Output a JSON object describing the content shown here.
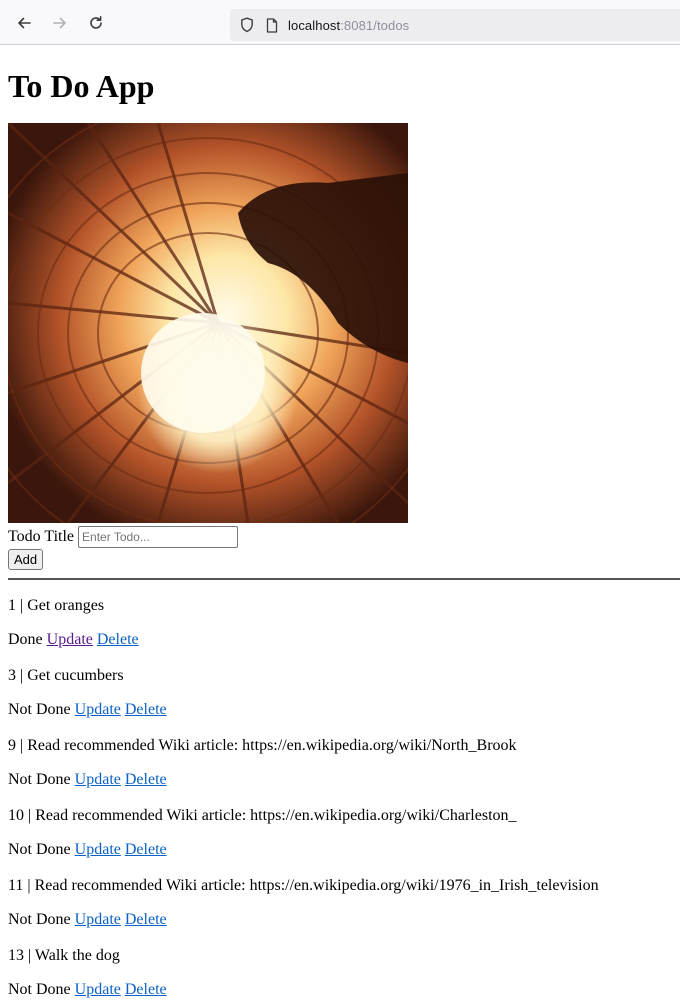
{
  "browser": {
    "url_host": "localhost",
    "url_rest": ":8081/todos"
  },
  "page": {
    "title": "To Do App",
    "form": {
      "label": "Todo Title",
      "placeholder": "Enter Todo...",
      "value": "",
      "add_label": "Add"
    },
    "todos": [
      {
        "title": "1 | Get oranges",
        "status": "Done",
        "update": "Update",
        "delete": "Delete"
      },
      {
        "title": "3 | Get cucumbers",
        "status": "Not Done",
        "update": "Update",
        "delete": "Delete"
      },
      {
        "title": "9 | Read recommended Wiki article: https://en.wikipedia.org/wiki/North_Brook",
        "status": "Not Done",
        "update": "Update",
        "delete": "Delete"
      },
      {
        "title": "10 | Read recommended Wiki article: https://en.wikipedia.org/wiki/Charleston_",
        "status": "Not Done",
        "update": "Update",
        "delete": "Delete"
      },
      {
        "title": "11 | Read recommended Wiki article: https://en.wikipedia.org/wiki/1976_in_Irish_television",
        "status": "Not Done",
        "update": "Update",
        "delete": "Delete"
      },
      {
        "title": "13 | Walk the dog",
        "status": "Not Done",
        "update": "Update",
        "delete": "Delete"
      }
    ]
  },
  "colors": {
    "link": "#0b61c5",
    "visited_link": "#551a8b"
  }
}
